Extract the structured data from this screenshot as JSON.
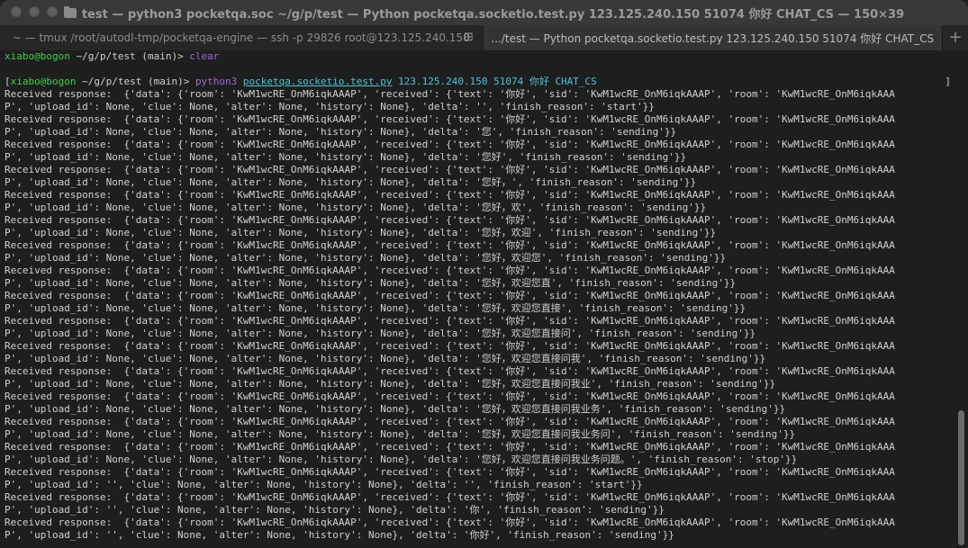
{
  "window": {
    "title": "test — python3 pocketqa.soc ~/g/p/test — Python pocketqa.socketio.test.py 123.125.240.150 51074 你好 CHAT_CS — 150×39"
  },
  "tabs": [
    {
      "label": "~ — tmux /root/autodl-tmp/pocketqa-engine — ssh -p 29826 root@123.125.240.150",
      "close_glyph": "⊞"
    },
    {
      "label": ".../test — Python pocketqa.socketio.test.py 123.125.240.150 51074 你好 CHAT_CS"
    }
  ],
  "tab_add_glyph": "+",
  "terminal": {
    "prompt1": {
      "user": "xiabo@bogon",
      "path": " ~/g/p/test (main)> ",
      "cmd": "clear"
    },
    "prompt2": {
      "bracket": "[",
      "user": "xiabo@bogon",
      "path": " ~/g/p/test (main)> ",
      "cmd": "python3 ",
      "file": "pocketqa.socketio.test.py",
      "args": " 123.125.240.150 51074 你好 CHAT_CS",
      "rbracket": "]"
    },
    "lines": [
      "Received response:  {'data': {'room': 'KwM1wcRE_OnM6iqkAAAP', 'received': {'text': '你好', 'sid': 'KwM1wcRE_OnM6iqkAAAP', 'room': 'KwM1wcRE_OnM6iqkAAA",
      "P', 'upload_id': None, 'clue': None, 'alter': None, 'history': None}, 'delta': '', 'finish_reason': 'start'}}",
      "Received response:  {'data': {'room': 'KwM1wcRE_OnM6iqkAAAP', 'received': {'text': '你好', 'sid': 'KwM1wcRE_OnM6iqkAAAP', 'room': 'KwM1wcRE_OnM6iqkAAA",
      "P', 'upload_id': None, 'clue': None, 'alter': None, 'history': None}, 'delta': '您', 'finish_reason': 'sending'}}",
      "Received response:  {'data': {'room': 'KwM1wcRE_OnM6iqkAAAP', 'received': {'text': '你好', 'sid': 'KwM1wcRE_OnM6iqkAAAP', 'room': 'KwM1wcRE_OnM6iqkAAA",
      "P', 'upload_id': None, 'clue': None, 'alter': None, 'history': None}, 'delta': '您好', 'finish_reason': 'sending'}}",
      "Received response:  {'data': {'room': 'KwM1wcRE_OnM6iqkAAAP', 'received': {'text': '你好', 'sid': 'KwM1wcRE_OnM6iqkAAAP', 'room': 'KwM1wcRE_OnM6iqkAAA",
      "P', 'upload_id': None, 'clue': None, 'alter': None, 'history': None}, 'delta': '您好，', 'finish_reason': 'sending'}}",
      "Received response:  {'data': {'room': 'KwM1wcRE_OnM6iqkAAAP', 'received': {'text': '你好', 'sid': 'KwM1wcRE_OnM6iqkAAAP', 'room': 'KwM1wcRE_OnM6iqkAAA",
      "P', 'upload_id': None, 'clue': None, 'alter': None, 'history': None}, 'delta': '您好，欢', 'finish_reason': 'sending'}}",
      "Received response:  {'data': {'room': 'KwM1wcRE_OnM6iqkAAAP', 'received': {'text': '你好', 'sid': 'KwM1wcRE_OnM6iqkAAAP', 'room': 'KwM1wcRE_OnM6iqkAAA",
      "P', 'upload_id': None, 'clue': None, 'alter': None, 'history': None}, 'delta': '您好，欢迎', 'finish_reason': 'sending'}}",
      "Received response:  {'data': {'room': 'KwM1wcRE_OnM6iqkAAAP', 'received': {'text': '你好', 'sid': 'KwM1wcRE_OnM6iqkAAAP', 'room': 'KwM1wcRE_OnM6iqkAAA",
      "P', 'upload_id': None, 'clue': None, 'alter': None, 'history': None}, 'delta': '您好，欢迎您', 'finish_reason': 'sending'}}",
      "Received response:  {'data': {'room': 'KwM1wcRE_OnM6iqkAAAP', 'received': {'text': '你好', 'sid': 'KwM1wcRE_OnM6iqkAAAP', 'room': 'KwM1wcRE_OnM6iqkAAA",
      "P', 'upload_id': None, 'clue': None, 'alter': None, 'history': None}, 'delta': '您好，欢迎您直', 'finish_reason': 'sending'}}",
      "Received response:  {'data': {'room': 'KwM1wcRE_OnM6iqkAAAP', 'received': {'text': '你好', 'sid': 'KwM1wcRE_OnM6iqkAAAP', 'room': 'KwM1wcRE_OnM6iqkAAA",
      "P', 'upload_id': None, 'clue': None, 'alter': None, 'history': None}, 'delta': '您好，欢迎您直接', 'finish_reason': 'sending'}}",
      "Received response:  {'data': {'room': 'KwM1wcRE_OnM6iqkAAAP', 'received': {'text': '你好', 'sid': 'KwM1wcRE_OnM6iqkAAAP', 'room': 'KwM1wcRE_OnM6iqkAAA",
      "P', 'upload_id': None, 'clue': None, 'alter': None, 'history': None}, 'delta': '您好，欢迎您直接问', 'finish_reason': 'sending'}}",
      "Received response:  {'data': {'room': 'KwM1wcRE_OnM6iqkAAAP', 'received': {'text': '你好', 'sid': 'KwM1wcRE_OnM6iqkAAAP', 'room': 'KwM1wcRE_OnM6iqkAAA",
      "P', 'upload_id': None, 'clue': None, 'alter': None, 'history': None}, 'delta': '您好，欢迎您直接问我', 'finish_reason': 'sending'}}",
      "Received response:  {'data': {'room': 'KwM1wcRE_OnM6iqkAAAP', 'received': {'text': '你好', 'sid': 'KwM1wcRE_OnM6iqkAAAP', 'room': 'KwM1wcRE_OnM6iqkAAA",
      "P', 'upload_id': None, 'clue': None, 'alter': None, 'history': None}, 'delta': '您好，欢迎您直接问我业', 'finish_reason': 'sending'}}",
      "Received response:  {'data': {'room': 'KwM1wcRE_OnM6iqkAAAP', 'received': {'text': '你好', 'sid': 'KwM1wcRE_OnM6iqkAAAP', 'room': 'KwM1wcRE_OnM6iqkAAA",
      "P', 'upload_id': None, 'clue': None, 'alter': None, 'history': None}, 'delta': '您好，欢迎您直接问我业务', 'finish_reason': 'sending'}}",
      "Received response:  {'data': {'room': 'KwM1wcRE_OnM6iqkAAAP', 'received': {'text': '你好', 'sid': 'KwM1wcRE_OnM6iqkAAAP', 'room': 'KwM1wcRE_OnM6iqkAAA",
      "P', 'upload_id': None, 'clue': None, 'alter': None, 'history': None}, 'delta': '您好，欢迎您直接问我业务问', 'finish_reason': 'sending'}}",
      "Received response:  {'data': {'room': 'KwM1wcRE_OnM6iqkAAAP', 'received': {'text': '你好', 'sid': 'KwM1wcRE_OnM6iqkAAAP', 'room': 'KwM1wcRE_OnM6iqkAAA",
      "P', 'upload_id': None, 'clue': None, 'alter': None, 'history': None}, 'delta': '您好，欢迎您直接问我业务问题。', 'finish_reason': 'stop'}}",
      "Received response:  {'data': {'room': 'KwM1wcRE_OnM6iqkAAAP', 'received': {'text': '你好', 'sid': 'KwM1wcRE_OnM6iqkAAAP', 'room': 'KwM1wcRE_OnM6iqkAAA",
      "P', 'upload_id': '', 'clue': None, 'alter': None, 'history': None}, 'delta': '', 'finish_reason': 'start'}}",
      "Received response:  {'data': {'room': 'KwM1wcRE_OnM6iqkAAAP', 'received': {'text': '你好', 'sid': 'KwM1wcRE_OnM6iqkAAAP', 'room': 'KwM1wcRE_OnM6iqkAAA",
      "P', 'upload_id': '', 'clue': None, 'alter': None, 'history': None}, 'delta': '你', 'finish_reason': 'sending'}}",
      "Received response:  {'data': {'room': 'KwM1wcRE_OnM6iqkAAAP', 'received': {'text': '你好', 'sid': 'KwM1wcRE_OnM6iqkAAAP', 'room': 'KwM1wcRE_OnM6iqkAAA",
      "P', 'upload_id': '', 'clue': None, 'alter': None, 'history': None}, 'delta': '你好', 'finish_reason': 'sending'}}"
    ]
  },
  "colors": {
    "prompt_user": "#3fd14a",
    "prompt_cmd": "#9b6bd6",
    "cmd_args": "#4fc3d6",
    "text": "#d0d0d0",
    "background": "#1e1e1e"
  }
}
